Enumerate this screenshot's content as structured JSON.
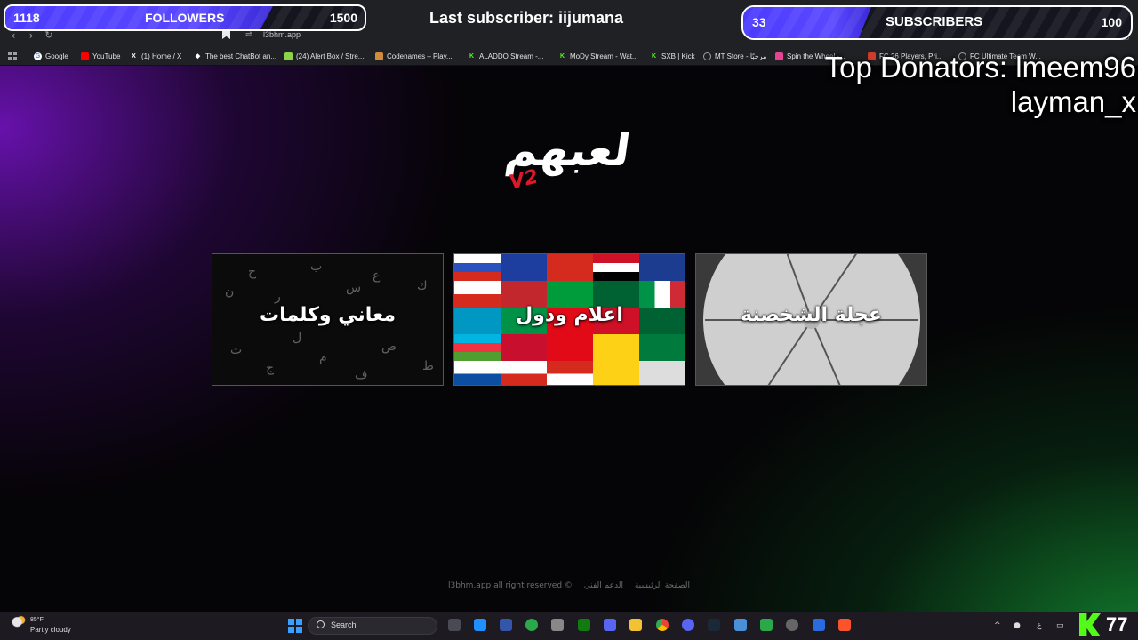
{
  "browser": {
    "url": "l3bhm.app",
    "bookmarks": [
      {
        "label": "Google",
        "icon": "google-icon",
        "color": "#4285f4"
      },
      {
        "label": "YouTube",
        "icon": "youtube-icon",
        "color": "#ff0000"
      },
      {
        "label": "(1) Home / X",
        "icon": "x-icon",
        "color": "#000000"
      },
      {
        "label": "The best ChatBot an...",
        "icon": "chatbot-icon",
        "color": "#ffffff"
      },
      {
        "label": "(24) Alert Box / Stre...",
        "icon": "streamelements-icon",
        "color": "#8bd44a"
      },
      {
        "label": "Codenames – Play...",
        "icon": "codenames-icon",
        "color": "#d08b3c"
      },
      {
        "label": "ALADDO Stream -...",
        "icon": "kick-icon",
        "color": "#53fc18"
      },
      {
        "label": "MoDy Stream - Wat...",
        "icon": "kick-icon",
        "color": "#53fc18"
      },
      {
        "label": "SXB | Kick",
        "icon": "kick-icon",
        "color": "#53fc18"
      },
      {
        "label": "MT Store - مرحبًا",
        "icon": "globe-icon",
        "color": "#9aa0a6"
      },
      {
        "label": "Spin the Wheel -...",
        "icon": "wheel-icon",
        "color": "#e84393"
      },
      {
        "label": "FC 26 Players, Pri...",
        "icon": "futbin-icon",
        "color": "#d23a2a"
      },
      {
        "label": "FC Ultimate Team W...",
        "icon": "globe-icon",
        "color": "#9aa0a6"
      }
    ]
  },
  "overlay": {
    "followers": {
      "current": "1118",
      "label": "FOLLOWERS",
      "goal": "1500",
      "progress": 0.745
    },
    "subscribers": {
      "current": "33",
      "label": "SUBSCRIBERS",
      "goal": "100",
      "progress": 0.33
    },
    "last_subscriber": "Last subscriber: iijumana",
    "top_donators_line1": "Top Donators: lmeem96",
    "top_donators_line2": "layman_x"
  },
  "page": {
    "logo_text": "لعبهم",
    "logo_version": "V2",
    "cards": [
      {
        "title": "معاني وكلمات"
      },
      {
        "title": "اعلام ودول"
      },
      {
        "title": "عجلة الشخصنة"
      }
    ],
    "footer": {
      "home": "الصفحة الرئيسية",
      "support": "الدعم الفني",
      "copyright": "l3bhm.app all right reserved ©"
    }
  },
  "taskbar": {
    "weather_temp": "85°F",
    "weather_desc": "Partly cloudy",
    "search_placeholder": "Search",
    "viewer_count": "77",
    "tray_lang": "ع"
  },
  "colors": {
    "accent_purple": "#5a48ff",
    "kick_green": "#53fc18",
    "logo_red": "#e0162b"
  }
}
